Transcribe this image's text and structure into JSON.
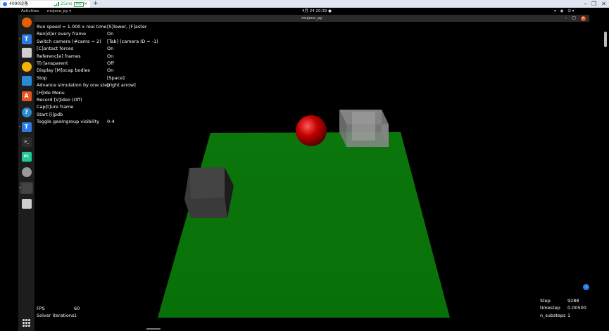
{
  "client": {
    "tab_title": "4090设备",
    "ping": "25ms",
    "quality_badge": "HD",
    "tab_close_icon": "close-icon",
    "add_tab_label": "+",
    "window_controls": [
      "–",
      "❐",
      "✕"
    ],
    "accent_color": "#2c7be5"
  },
  "top_bar": {
    "activities": "Activities",
    "app_menu": "mujoco_py ▾",
    "clock": "4月 24 20:39 ●",
    "tray": [
      "▾",
      "◉",
      "⏻ ▾"
    ]
  },
  "dock": {
    "items": [
      {
        "name": "firefox-icon",
        "glyph": "",
        "color": "#e66000"
      },
      {
        "name": "todesk-icon",
        "glyph": "T",
        "color": "#2c7be5"
      },
      {
        "name": "files-icon",
        "glyph": "",
        "color": "#cfcfcf"
      },
      {
        "name": "rhythmbox-icon",
        "glyph": "",
        "color": "#f6b400"
      },
      {
        "name": "libreoffice-writer-icon",
        "glyph": "",
        "color": "#2a8ad4"
      },
      {
        "name": "app-center-icon",
        "glyph": "A",
        "color": "#e95420"
      },
      {
        "name": "help-icon",
        "glyph": "?",
        "color": "#2a8ad4"
      },
      {
        "name": "todesk-icon",
        "glyph": "T",
        "color": "#2c7be5"
      },
      {
        "name": "terminal-icon",
        "glyph": ">_",
        "color": "#2c2c2c"
      },
      {
        "name": "pycharm-icon",
        "glyph": "PC",
        "color": "#20c997"
      },
      {
        "name": "settings-icon",
        "glyph": "",
        "color": "#9a9a9a"
      },
      {
        "name": "mujoco-window-icon",
        "glyph": "",
        "color": "#444"
      },
      {
        "name": "trash-icon",
        "glyph": "",
        "color": "#cfcfcf"
      }
    ],
    "show_apps_icon": "grid-icon"
  },
  "window": {
    "title": "mujoco_py",
    "controls": [
      "–",
      "▢",
      "✕"
    ]
  },
  "menu": {
    "labels": [
      "Run speed = 1.000 x real time",
      "Ren[d]er every frame",
      "Switch camera (#cams = 2)",
      "[C]ontact forces",
      "Referenc[e] frames",
      "T[r]ansparent",
      "Display [M]ocap bodies",
      "Stop",
      "Advance simulation by one step",
      "[H]ide Menu",
      "Record [V]ideo (Off)",
      "Cap[t]ure frame",
      "Start [i]pdb",
      "Toggle geomgroup visibility"
    ],
    "values": [
      "[S]lower, [F]aster",
      "On",
      "[Tab] (camera ID = -1)",
      "On",
      "On",
      "Off",
      "On",
      "[Space]",
      "[right arrow]",
      "",
      "",
      "",
      "",
      "0-4"
    ]
  },
  "stats": {
    "labels": [
      "FPS",
      "Solver iterations"
    ],
    "values": [
      "60",
      "1"
    ]
  },
  "step_info": {
    "labels": [
      "Step",
      "timestep",
      "n_substeps"
    ],
    "values": [
      "9288",
      "0.00500",
      "1"
    ]
  },
  "scene": {
    "floor_color": "#0a6e0a",
    "sphere_color": "#b30000",
    "box_color": "#3a3a3a",
    "mocap_box_color": "#8a8a8a"
  }
}
